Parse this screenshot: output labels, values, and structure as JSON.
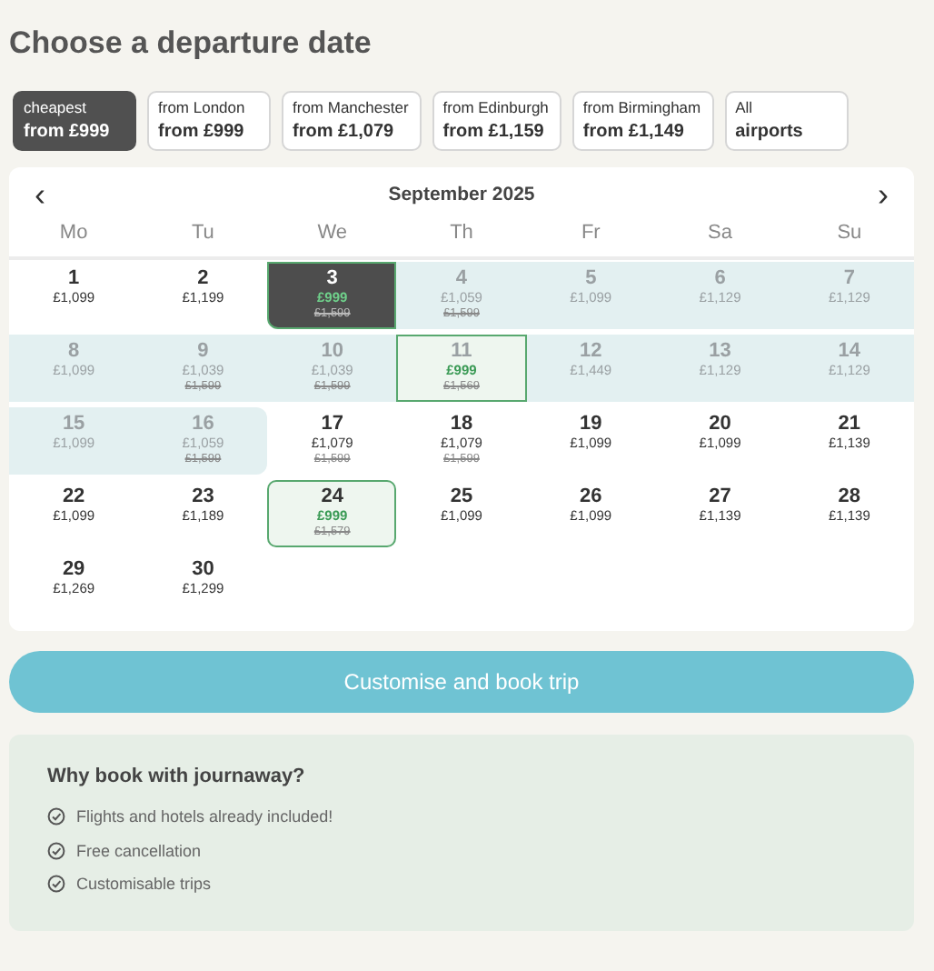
{
  "title": "Choose a departure date",
  "filters": [
    {
      "label": "cheapest",
      "price": "from £999",
      "selected": true
    },
    {
      "label": "from London",
      "price": "from £999",
      "selected": false
    },
    {
      "label": "from Manchester",
      "price": "from £1,079",
      "selected": false
    },
    {
      "label": "from Edinburgh",
      "price": "from £1,159",
      "selected": false
    },
    {
      "label": "from Birmingham",
      "price": "from £1,149",
      "selected": false
    },
    {
      "label": "All",
      "price": "airports",
      "selected": false
    }
  ],
  "calendar": {
    "prev": "‹",
    "month": "September 2025",
    "next": "›",
    "weekdays": [
      "Mo",
      "Tu",
      "We",
      "Th",
      "Fr",
      "Sa",
      "Su"
    ],
    "days": [
      {
        "day": "1",
        "price": "£1,099",
        "selected": false,
        "in_range": false,
        "deal": false
      },
      {
        "day": "2",
        "price": "£1,199",
        "selected": false,
        "in_range": false,
        "deal": false
      },
      {
        "day": "3",
        "price": "£999",
        "old_price": "£1,599",
        "selected": true,
        "in_range": false,
        "deal": true
      },
      {
        "day": "4",
        "price": "£1,059",
        "old_price": "£1,599",
        "selected": false,
        "in_range": true,
        "deal": false
      },
      {
        "day": "5",
        "price": "£1,099",
        "selected": false,
        "in_range": true,
        "deal": false
      },
      {
        "day": "6",
        "price": "£1,129",
        "selected": false,
        "in_range": true,
        "deal": false
      },
      {
        "day": "7",
        "price": "£1,129",
        "selected": false,
        "in_range": true,
        "deal": false
      },
      {
        "day": "8",
        "price": "£1,099",
        "selected": false,
        "in_range": true,
        "deal": false
      },
      {
        "day": "9",
        "price": "£1,039",
        "old_price": "£1,599",
        "selected": false,
        "in_range": true,
        "deal": false
      },
      {
        "day": "10",
        "price": "£1,039",
        "old_price": "£1,599",
        "selected": false,
        "in_range": true,
        "deal": false
      },
      {
        "day": "11",
        "price": "£999",
        "old_price": "£1,569",
        "selected": false,
        "in_range": true,
        "deal": true
      },
      {
        "day": "12",
        "price": "£1,449",
        "selected": false,
        "in_range": true,
        "deal": false
      },
      {
        "day": "13",
        "price": "£1,129",
        "selected": false,
        "in_range": true,
        "deal": false
      },
      {
        "day": "14",
        "price": "£1,129",
        "selected": false,
        "in_range": true,
        "deal": false
      },
      {
        "day": "15",
        "price": "£1,099",
        "selected": false,
        "in_range": true,
        "deal": false
      },
      {
        "day": "16",
        "price": "£1,059",
        "old_price": "£1,599",
        "selected": false,
        "in_range": true,
        "deal": false
      },
      {
        "day": "17",
        "price": "£1,079",
        "old_price": "£1,599",
        "selected": false,
        "in_range": false,
        "deal": false
      },
      {
        "day": "18",
        "price": "£1,079",
        "old_price": "£1,599",
        "selected": false,
        "in_range": false,
        "deal": false
      },
      {
        "day": "19",
        "price": "£1,099",
        "selected": false,
        "in_range": false,
        "deal": false
      },
      {
        "day": "20",
        "price": "£1,099",
        "selected": false,
        "in_range": false,
        "deal": false
      },
      {
        "day": "21",
        "price": "£1,139",
        "selected": false,
        "in_range": false,
        "deal": false
      },
      {
        "day": "22",
        "price": "£1,099",
        "selected": false,
        "in_range": false,
        "deal": false
      },
      {
        "day": "23",
        "price": "£1,189",
        "selected": false,
        "in_range": false,
        "deal": false
      },
      {
        "day": "24",
        "price": "£999",
        "old_price": "£1,579",
        "selected": false,
        "in_range": false,
        "deal": true
      },
      {
        "day": "25",
        "price": "£1,099",
        "selected": false,
        "in_range": false,
        "deal": false
      },
      {
        "day": "26",
        "price": "£1,099",
        "selected": false,
        "in_range": false,
        "deal": false
      },
      {
        "day": "27",
        "price": "£1,139",
        "selected": false,
        "in_range": false,
        "deal": false
      },
      {
        "day": "28",
        "price": "£1,139",
        "selected": false,
        "in_range": false,
        "deal": false
      },
      {
        "day": "29",
        "price": "£1,269",
        "selected": false,
        "in_range": false,
        "deal": false
      },
      {
        "day": "30",
        "price": "£1,299",
        "selected": false,
        "in_range": false,
        "deal": false
      }
    ]
  },
  "book_button": "Customise and book trip",
  "benefits": {
    "title": "Why book with journaway?",
    "items": [
      "Flights and hotels already included!",
      "Free cancellation",
      "Customisable trips"
    ]
  }
}
